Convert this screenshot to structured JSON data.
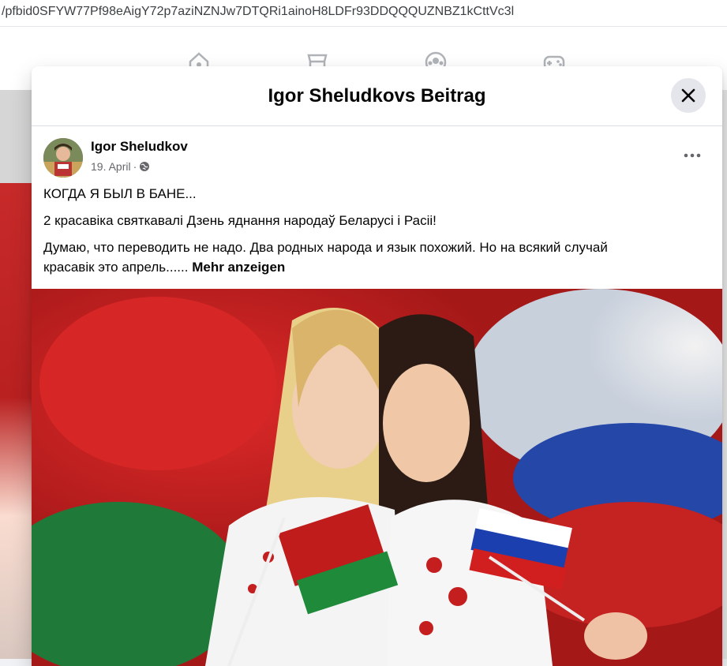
{
  "browser": {
    "url": "/pfbid0SFYW77Pf98eAigY72p7aziNZNJw7DTQRi1ainoH8LDFr93DDQQQUZNBZ1kCttVc3l"
  },
  "nav": {
    "icons": [
      "home-icon",
      "marketplace-icon",
      "groups-icon",
      "gaming-icon"
    ]
  },
  "modal": {
    "title": "Igor Sheludkovs Beitrag",
    "close_icon": "close-icon"
  },
  "post": {
    "author": "Igor Sheludkov",
    "date": "19. April",
    "separator": "·",
    "privacy_icon": "globe-icon",
    "more_icon": "more-options-icon",
    "lines": [
      "КОГДА Я БЫЛ В БАНЕ...",
      "2 красавіка святкавалі Дзень яднання народаў Беларусі і Расіі!",
      "Думаю, что переводить не надо. Два родных народа и язык похожий. Но на всякий случай",
      "красавік это апрель......"
    ],
    "see_more": "Mehr anzeigen"
  },
  "colors": {
    "accent_blue": "#1877f2",
    "text": "#050505",
    "meta": "#65676b"
  }
}
